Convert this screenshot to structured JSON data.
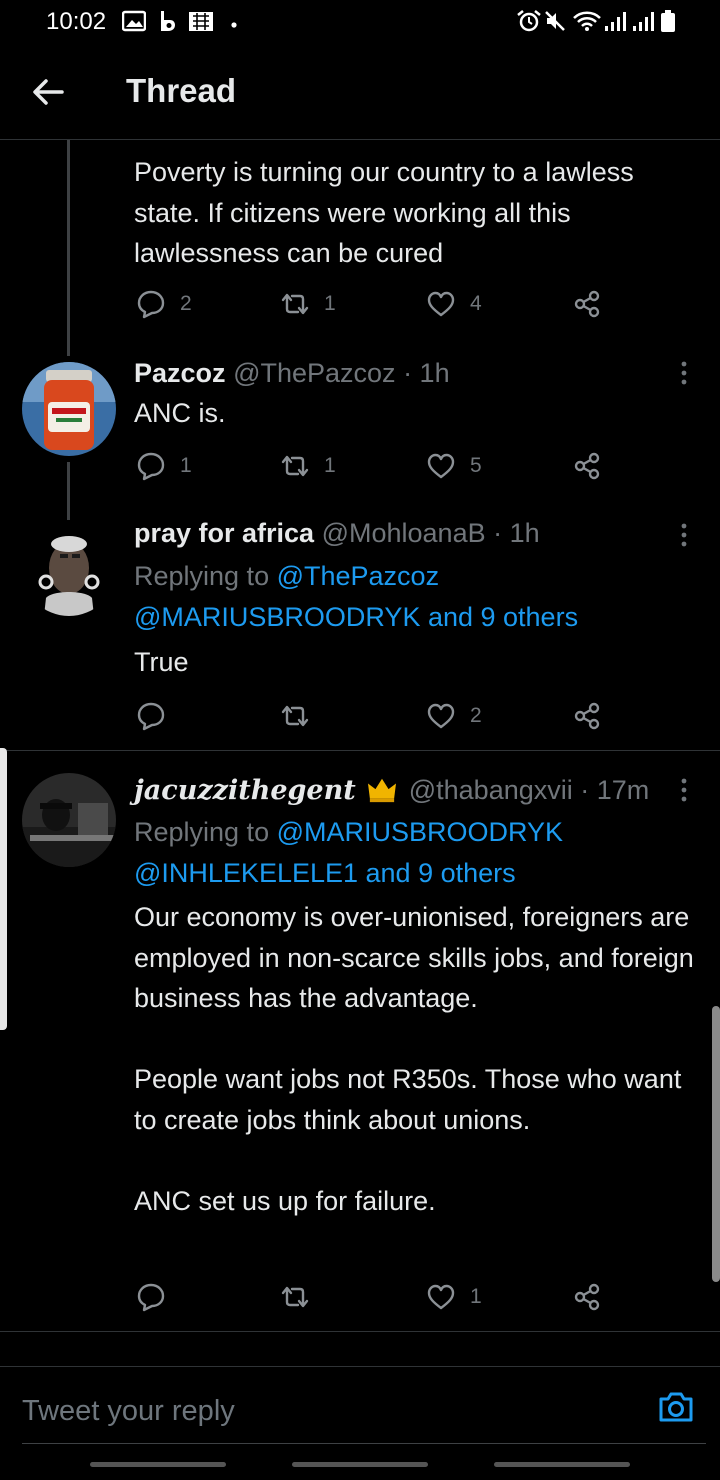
{
  "status_bar": {
    "time": "10:02"
  },
  "header": {
    "title": "Thread"
  },
  "tweets": [
    {
      "text": "Poverty is turning our country to a lawless state. If citizens were working all this lawlessness can be cured",
      "replies": "2",
      "retweets": "1",
      "likes": "4"
    },
    {
      "name": "Pazcoz",
      "handle": "@ThePazcoz",
      "time": "· 1h",
      "text": "ANC is.",
      "replies": "1",
      "retweets": "1",
      "likes": "5"
    },
    {
      "name": "pray for africa",
      "handle": "@MohloanaB",
      "time": "· 1h",
      "replying_prefix": "Replying to ",
      "replying_to": "@ThePazcoz",
      "replying_line2": "@MARIUSBROODRYK and 9 others",
      "text": "True",
      "replies": "",
      "retweets": "",
      "likes": "2"
    },
    {
      "name": "jacuzzithegent",
      "handle": "@thabangxvii",
      "time": "· 17m",
      "replying_prefix": "Replying to ",
      "replying_to": "@MARIUSBROODRYK",
      "replying_line2": "@INHLEKELELE1 and 9 others",
      "text": "Our economy is over-unionised, foreigners are employed in non-scarce skills jobs, and foreign business has the advantage.\n\nPeople want jobs not R350s. Those who want to create jobs think about unions.\n\nANC set us up for failure.",
      "replies": "",
      "retweets": "",
      "likes": "1"
    }
  ],
  "composer": {
    "placeholder": "Tweet your reply"
  },
  "colors": {
    "background": "#000000",
    "link": "#1d9bf0",
    "muted": "#71767b",
    "text": "#e7e9ea",
    "divider": "#2f3336"
  }
}
